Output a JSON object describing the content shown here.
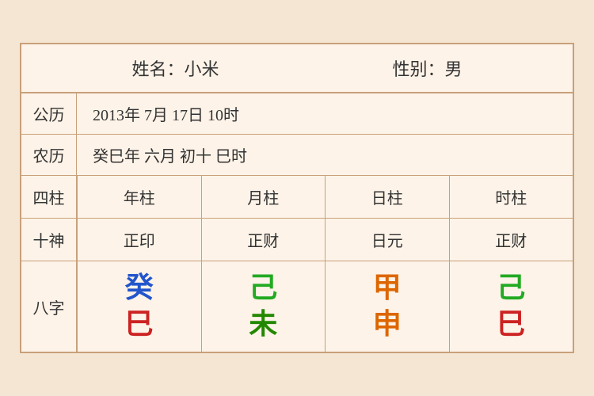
{
  "header": {
    "name_label": "姓名：小米",
    "gender_label": "性别：男"
  },
  "solar": {
    "label": "公历",
    "value": "2013年 7月 17日 10时"
  },
  "lunar": {
    "label": "农历",
    "value": "癸巳年 六月 初十 巳时"
  },
  "four_pillars": {
    "label": "四柱",
    "columns": [
      "年柱",
      "月柱",
      "日柱",
      "时柱"
    ]
  },
  "ten_gods": {
    "label": "十神",
    "columns": [
      "正印",
      "正财",
      "日元",
      "正财"
    ]
  },
  "bazhi": {
    "label": "八字",
    "cells": [
      {
        "top": "癸",
        "bottom": "巳",
        "top_color": "color-blue",
        "bottom_color": "color-red"
      },
      {
        "top": "己",
        "bottom": "未",
        "top_color": "color-green",
        "bottom_color": "color-dark-green"
      },
      {
        "top": "甲",
        "bottom": "申",
        "top_color": "color-orange",
        "bottom_color": "color-orange"
      },
      {
        "top": "己",
        "bottom": "巳",
        "top_color": "color-green2",
        "bottom_color": "color-red"
      }
    ]
  }
}
